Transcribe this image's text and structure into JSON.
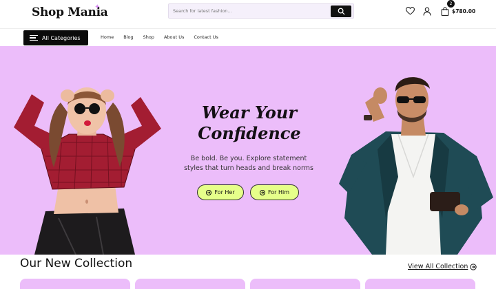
{
  "header": {
    "logo": "Shop Mania",
    "search_placeholder": "Search for latest fashion...",
    "cart_count": "2",
    "cart_total": "$780.00"
  },
  "nav": {
    "categories_label": "All Categories",
    "menu": [
      "Home",
      "Blog",
      "Shop",
      "About Us",
      "Contact Us"
    ]
  },
  "hero": {
    "title_line1": "Wear Your",
    "title_line2": "Confidence",
    "subtitle_line1": "Be bold. Be you. Explore statement",
    "subtitle_line2": "styles that turn heads and break norms",
    "button_her": "For Her",
    "button_him": "For Him",
    "background_color": "#ecbdfa",
    "button_color": "#e6ff8a"
  },
  "collection": {
    "title": "Our New Collection",
    "view_all": "View All Collection"
  }
}
